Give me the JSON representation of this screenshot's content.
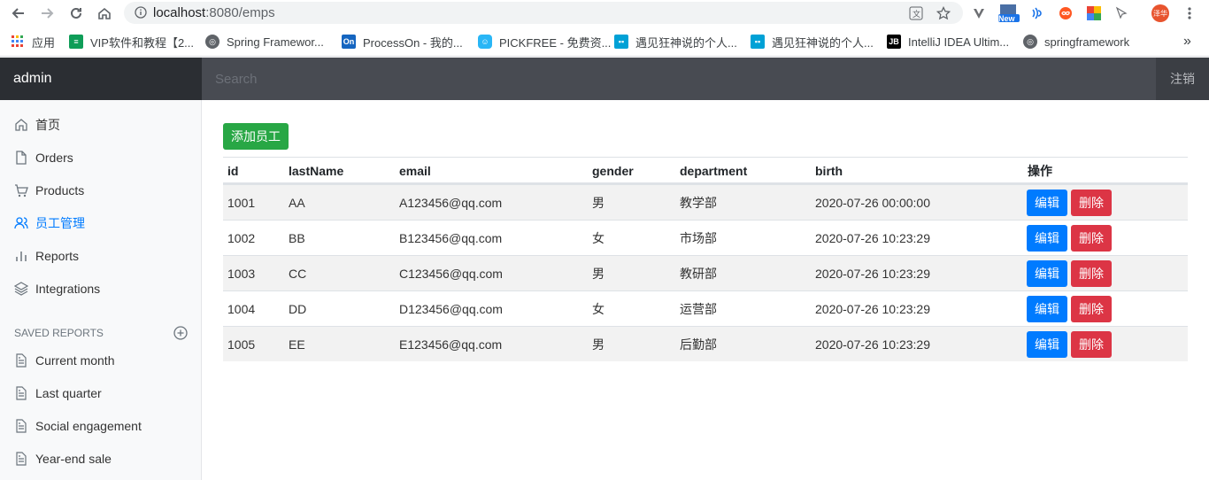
{
  "browser": {
    "url_host": "localhost",
    "url_path": ":8080/emps",
    "bookmarks": [
      {
        "icon": "apps-icon",
        "label": "应用"
      },
      {
        "icon": "vip-icon",
        "label": "VIP软件和教程【2..."
      },
      {
        "icon": "globe-icon",
        "label": "Spring Framewor..."
      },
      {
        "icon": "processon-icon",
        "label": "ProcessOn - 我的..."
      },
      {
        "icon": "pickfree-icon",
        "label": "PICKFREE - 免费资..."
      },
      {
        "icon": "bilibili-icon",
        "label": "遇见狂神说的个人..."
      },
      {
        "icon": "bilibili-icon",
        "label": "遇见狂神说的个人..."
      },
      {
        "icon": "jetbrains-icon",
        "label": "IntelliJ IDEA Ultim..."
      },
      {
        "icon": "globe-icon",
        "label": "springframework"
      }
    ],
    "more": "»",
    "profile_badge": "泽华",
    "ext_new_badge": "New"
  },
  "navbar": {
    "brand": "admin",
    "search_placeholder": "Search",
    "signout": "注销"
  },
  "sidebar": {
    "items": [
      {
        "label": "首页",
        "icon": "home-icon"
      },
      {
        "label": "Orders",
        "icon": "file-icon"
      },
      {
        "label": "Products",
        "icon": "cart-icon"
      },
      {
        "label": "员工管理",
        "icon": "users-icon",
        "active": true
      },
      {
        "label": "Reports",
        "icon": "bar-chart-icon"
      },
      {
        "label": "Integrations",
        "icon": "layers-icon"
      }
    ],
    "saved_reports_title": "SAVED REPORTS",
    "saved_reports": [
      {
        "label": "Current month"
      },
      {
        "label": "Last quarter"
      },
      {
        "label": "Social engagement"
      },
      {
        "label": "Year-end sale"
      }
    ]
  },
  "main": {
    "add_button": "添加员工",
    "columns": [
      "id",
      "lastName",
      "email",
      "gender",
      "department",
      "birth",
      "操作"
    ],
    "rows": [
      {
        "id": "1001",
        "lastName": "AA",
        "email": "A123456@qq.com",
        "gender": "男",
        "department": "教学部",
        "birth": "2020-07-26 00:00:00"
      },
      {
        "id": "1002",
        "lastName": "BB",
        "email": "B123456@qq.com",
        "gender": "女",
        "department": "市场部",
        "birth": "2020-07-26 10:23:29"
      },
      {
        "id": "1003",
        "lastName": "CC",
        "email": "C123456@qq.com",
        "gender": "男",
        "department": "教研部",
        "birth": "2020-07-26 10:23:29"
      },
      {
        "id": "1004",
        "lastName": "DD",
        "email": "D123456@qq.com",
        "gender": "女",
        "department": "运营部",
        "birth": "2020-07-26 10:23:29"
      },
      {
        "id": "1005",
        "lastName": "EE",
        "email": "E123456@qq.com",
        "gender": "男",
        "department": "后勤部",
        "birth": "2020-07-26 10:23:29"
      }
    ],
    "edit_label": "编辑",
    "delete_label": "删除"
  },
  "colors": {
    "navbar_bg": "#484b52",
    "brand_bg": "#2b2e33",
    "success": "#28a745",
    "primary": "#007bff",
    "danger": "#dc3545"
  }
}
